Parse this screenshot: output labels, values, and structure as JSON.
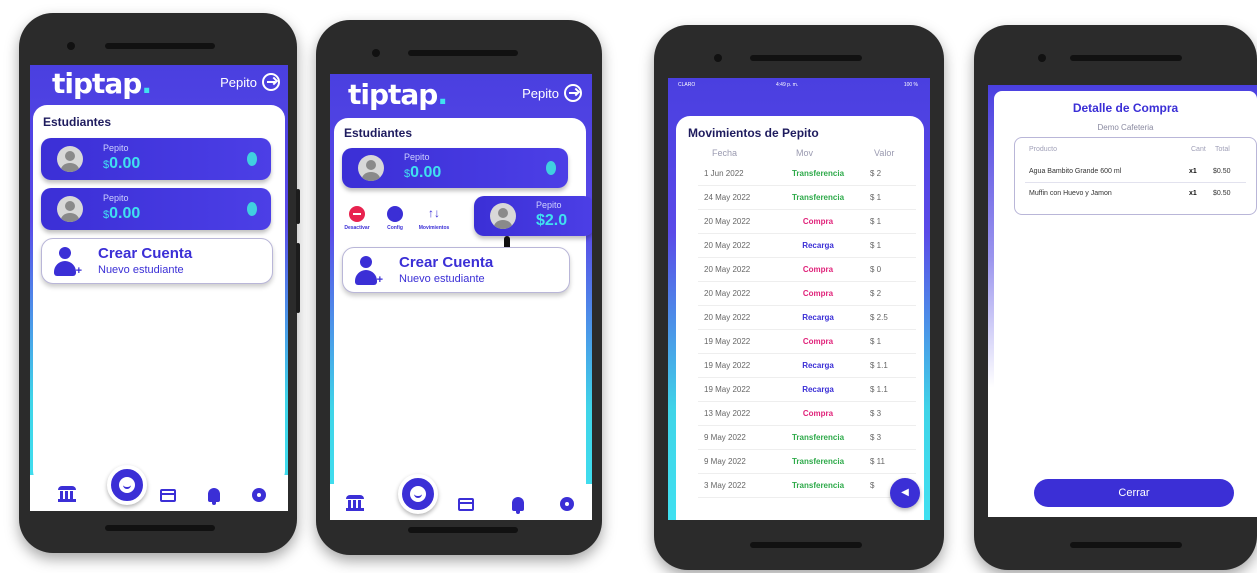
{
  "app": {
    "logo": "tiptap",
    "logo_dot": ".",
    "user": "Pepito"
  },
  "students_screen": {
    "section_title": "Estudiantes",
    "students": [
      {
        "name": "Pepito",
        "currency": "$",
        "balance": "0.00"
      },
      {
        "name": "Pepito",
        "currency": "$",
        "balance": "0.00"
      }
    ],
    "create": {
      "title": "Crear Cuenta",
      "subtitle": "Nuevo estudiante"
    }
  },
  "actions_screen": {
    "section_title": "Estudiantes",
    "student": {
      "name": "Pepito",
      "currency": "$",
      "balance": "0.00"
    },
    "swiped_student": {
      "name": "Pepito",
      "balance": "$2.0"
    },
    "actions": [
      {
        "label": "Desactivar",
        "icon": "minus-circle-icon",
        "color": "#e8234f"
      },
      {
        "label": "Config",
        "icon": "gear-icon",
        "color": "#3b2fd6"
      },
      {
        "label": "Movimientos",
        "icon": "arrows-updown-icon",
        "color": "#3b2fd6"
      }
    ],
    "create": {
      "title": "Crear Cuenta",
      "subtitle": "Nuevo estudiante"
    }
  },
  "nav": {
    "items": [
      "bank-icon",
      "tiptap-face-icon",
      "card-icon",
      "bell-icon",
      "gear-icon"
    ]
  },
  "movements": {
    "status": {
      "carrier": "CLARO",
      "time": "4:49 p. m.",
      "battery": "100 %"
    },
    "title": "Movimientos de Pepito",
    "headers": {
      "date": "Fecha",
      "mov": "Mov",
      "value": "Valor"
    },
    "rows": [
      {
        "date": "1 Jun 2022",
        "mov": "Transferencia",
        "value": "$ 2"
      },
      {
        "date": "24 May 2022",
        "mov": "Transferencia",
        "value": "$ 1"
      },
      {
        "date": "20 May 2022",
        "mov": "Compra",
        "value": "$ 1"
      },
      {
        "date": "20 May 2022",
        "mov": "Recarga",
        "value": "$ 1"
      },
      {
        "date": "20 May 2022",
        "mov": "Compra",
        "value": "$ 0"
      },
      {
        "date": "20 May 2022",
        "mov": "Compra",
        "value": "$ 2"
      },
      {
        "date": "20 May 2022",
        "mov": "Recarga",
        "value": "$ 2.5"
      },
      {
        "date": "19 May 2022",
        "mov": "Compra",
        "value": "$ 1"
      },
      {
        "date": "19 May 2022",
        "mov": "Recarga",
        "value": "$ 1.1"
      },
      {
        "date": "19 May 2022",
        "mov": "Recarga",
        "value": "$ 1.1"
      },
      {
        "date": "13 May 2022",
        "mov": "Compra",
        "value": "$ 3"
      },
      {
        "date": "9 May 2022",
        "mov": "Transferencia",
        "value": "$ 3"
      },
      {
        "date": "9 May 2022",
        "mov": "Transferencia",
        "value": "$ 11"
      },
      {
        "date": "3 May 2022",
        "mov": "Transferencia",
        "value": "$"
      }
    ],
    "colors": {
      "Transferencia": "#2eaa4a",
      "Compra": "#e0237a",
      "Recarga": "#3b2fd6"
    },
    "fab_icon": "chevron-left-icon"
  },
  "detail": {
    "title": "Detalle de Compra",
    "subtitle": "Demo Cafeteria",
    "headers": {
      "product": "Producto",
      "qty": "Cant",
      "total": "Total"
    },
    "items": [
      {
        "product": "Agua Bambito Grande 600 ml",
        "qty": "x1",
        "total": "$0.50"
      },
      {
        "product": "Muffin con Huevo y Jamon",
        "qty": "x1",
        "total": "$0.50"
      }
    ],
    "close_label": "Cerrar"
  }
}
